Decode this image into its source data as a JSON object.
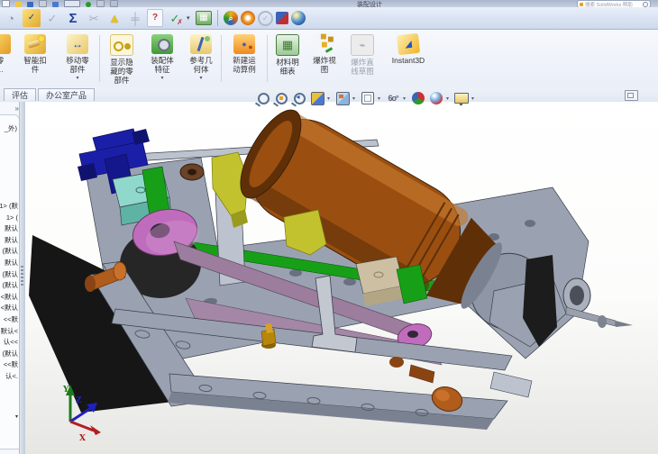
{
  "window": {
    "title": "装配设计",
    "search_placeholder": "搜索 SolidWorks 帮助",
    "collapse_chevron": "»"
  },
  "toolbar": {
    "icons": [
      {
        "name": "history-icon",
        "glyph": "◔"
      },
      {
        "name": "design-binder-icon",
        "glyph": "✓"
      },
      {
        "name": "select-check-icon",
        "glyph": "✓"
      },
      {
        "name": "equations-icon",
        "glyph": "Σ"
      },
      {
        "name": "measure-icon",
        "glyph": "✂"
      },
      {
        "name": "interference-detection-icon",
        "glyph": "▲"
      },
      {
        "name": "align-icon",
        "glyph": "╪"
      },
      {
        "name": "assembly-xpert-icon",
        "glyph": "?"
      },
      {
        "name": "clearance-verification-icon",
        "glyph": "✓"
      },
      {
        "name": "bom-table-icon",
        "glyph": "▦"
      },
      {
        "name": "visualization-icon",
        "glyph": "⌕"
      },
      {
        "name": "simulation-icon",
        "glyph": ""
      },
      {
        "name": "check-circle-icon",
        "glyph": "✓"
      },
      {
        "name": "compare-icon",
        "glyph": ""
      },
      {
        "name": "edrawings-icon",
        "glyph": ""
      }
    ],
    "dropdown_caret": "▾"
  },
  "ribbon": {
    "caret": "▾",
    "buttons": [
      {
        "label": "零\n…",
        "grayed": false,
        "dropdown": false
      },
      {
        "label": "智能扣\n件",
        "grayed": false,
        "dropdown": false
      },
      {
        "label": "移动零\n部件",
        "grayed": false,
        "dropdown": true
      },
      {
        "label": "显示隐\n藏的零\n部件",
        "grayed": false,
        "dropdown": true
      },
      {
        "label": "装配体\n特征",
        "grayed": false,
        "dropdown": true
      },
      {
        "label": "参考几\n何体",
        "grayed": false,
        "dropdown": true
      },
      {
        "label": "新建运\n动算例",
        "grayed": false,
        "dropdown": false
      },
      {
        "label": "材料明\n细表",
        "grayed": false,
        "dropdown": false
      },
      {
        "label": "爆炸视\n图",
        "grayed": false,
        "dropdown": false
      },
      {
        "label": "爆炸直\n线草图",
        "grayed": true,
        "dropdown": false
      },
      {
        "label": "Instant3D",
        "grayed": false,
        "dropdown": false
      }
    ]
  },
  "tabs": {
    "items": [
      {
        "label": "评估"
      },
      {
        "label": "办公室产品"
      }
    ]
  },
  "viewport_toolbar": {
    "icons": [
      "zoom-fit-icon",
      "zoom-area-icon",
      "previous-view-icon",
      "section-view-icon",
      "view-orientation-icon",
      "display-style-icon",
      "hide-show-items-icon",
      "edit-appearance-icon",
      "apply-scene-icon",
      "view-settings-icon"
    ],
    "glasses_label": "6ο°",
    "caret": "▾"
  },
  "sidebar": {
    "chevron": "»",
    "header_fragment": "_外)",
    "scroll_up": "▲",
    "scroll_down": "▾",
    "items": [
      "1> (默",
      "1> (",
      "默认",
      "默认",
      "(默认",
      "默认",
      "(默认",
      "(默认",
      "<默认",
      "<默认",
      "<<默",
      "默认<",
      "认<<",
      "(默认",
      "<<默",
      "认<."
    ]
  },
  "triad": {
    "x_label": "X",
    "y_label": "Y",
    "z_label": "Z",
    "x_color": "#b02020",
    "y_color": "#1e7a1e",
    "z_color": "#2020c0"
  },
  "model": {
    "parts": [
      "chassis-frame",
      "motor-cylinder",
      "spindle-head",
      "blue-bracket",
      "teal-block",
      "green-rail",
      "yellow-bracket",
      "pink-pulley",
      "drive-belt",
      "black-plate",
      "orange-pin",
      "tan-block",
      "brass-fitting",
      "right-bracket",
      "drill-tip"
    ],
    "colors": {
      "chassis": "#9aa2b2",
      "chassis_dark": "#7a8292",
      "chassis_light": "#bcc3ce",
      "motor": "#9a4f10",
      "motor_dark": "#5f3008",
      "motor_light": "#c47a2e",
      "head": "#8f97a6",
      "black_part": "#161616",
      "blue_bracket": "#1b1fa8",
      "teal_block": "#8fd8cb",
      "green_rail": "#17a017",
      "yellow_part": "#c2c22e",
      "pink_pulley": "#c06cbc",
      "belt": "#9c7d9e",
      "belt2": "#a487a6",
      "orange_pin": "#b05c1c",
      "tan_block": "#cdbfa2",
      "brass": "#b8860b",
      "edge": "#3a3f4a"
    }
  }
}
